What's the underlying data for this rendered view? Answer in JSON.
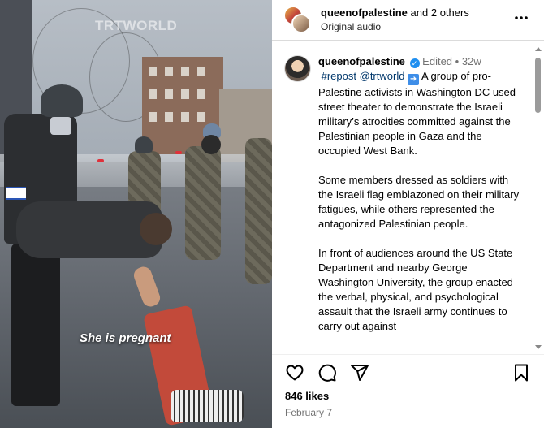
{
  "video": {
    "watermark": "TRTWORLD",
    "caption": "She is pregnant"
  },
  "header": {
    "username": "queenofpalestine",
    "others": "and 2 others",
    "audio": "Original audio",
    "more_icon": "more-horizontal-icon"
  },
  "post": {
    "username": "queenofpalestine",
    "verified_icon": "verified-badge-icon",
    "edited": "Edited",
    "dot": "•",
    "age": "32w",
    "hashtag": "#repost",
    "mention": "@trtworld",
    "arrow_emoji": "➡️",
    "paragraph1_rest": "A group of pro-Palestine activists in Washington DC used street theater to demonstrate the Israeli military’s atrocities committed against the Palestinian people in Gaza and the occupied West Bank.",
    "paragraph2": "Some members dressed as soldiers with the Israeli flag emblazoned on their military fatigues, while others represented the antagonized Palestinian people.",
    "paragraph3": "In front of audiences around the US State Department and nearby George Washington University, the group enacted the verbal, physical, and psychological assault that the Israeli army continues to carry out against"
  },
  "actions": {
    "like_icon": "heart-icon",
    "comment_icon": "comment-icon",
    "share_icon": "send-icon",
    "save_icon": "bookmark-icon"
  },
  "likes": "846 likes",
  "date": "February 7",
  "colors": {
    "link": "#00376b",
    "verified": "#1f8ff0",
    "muted": "#737373",
    "border": "#dbdbdb"
  }
}
